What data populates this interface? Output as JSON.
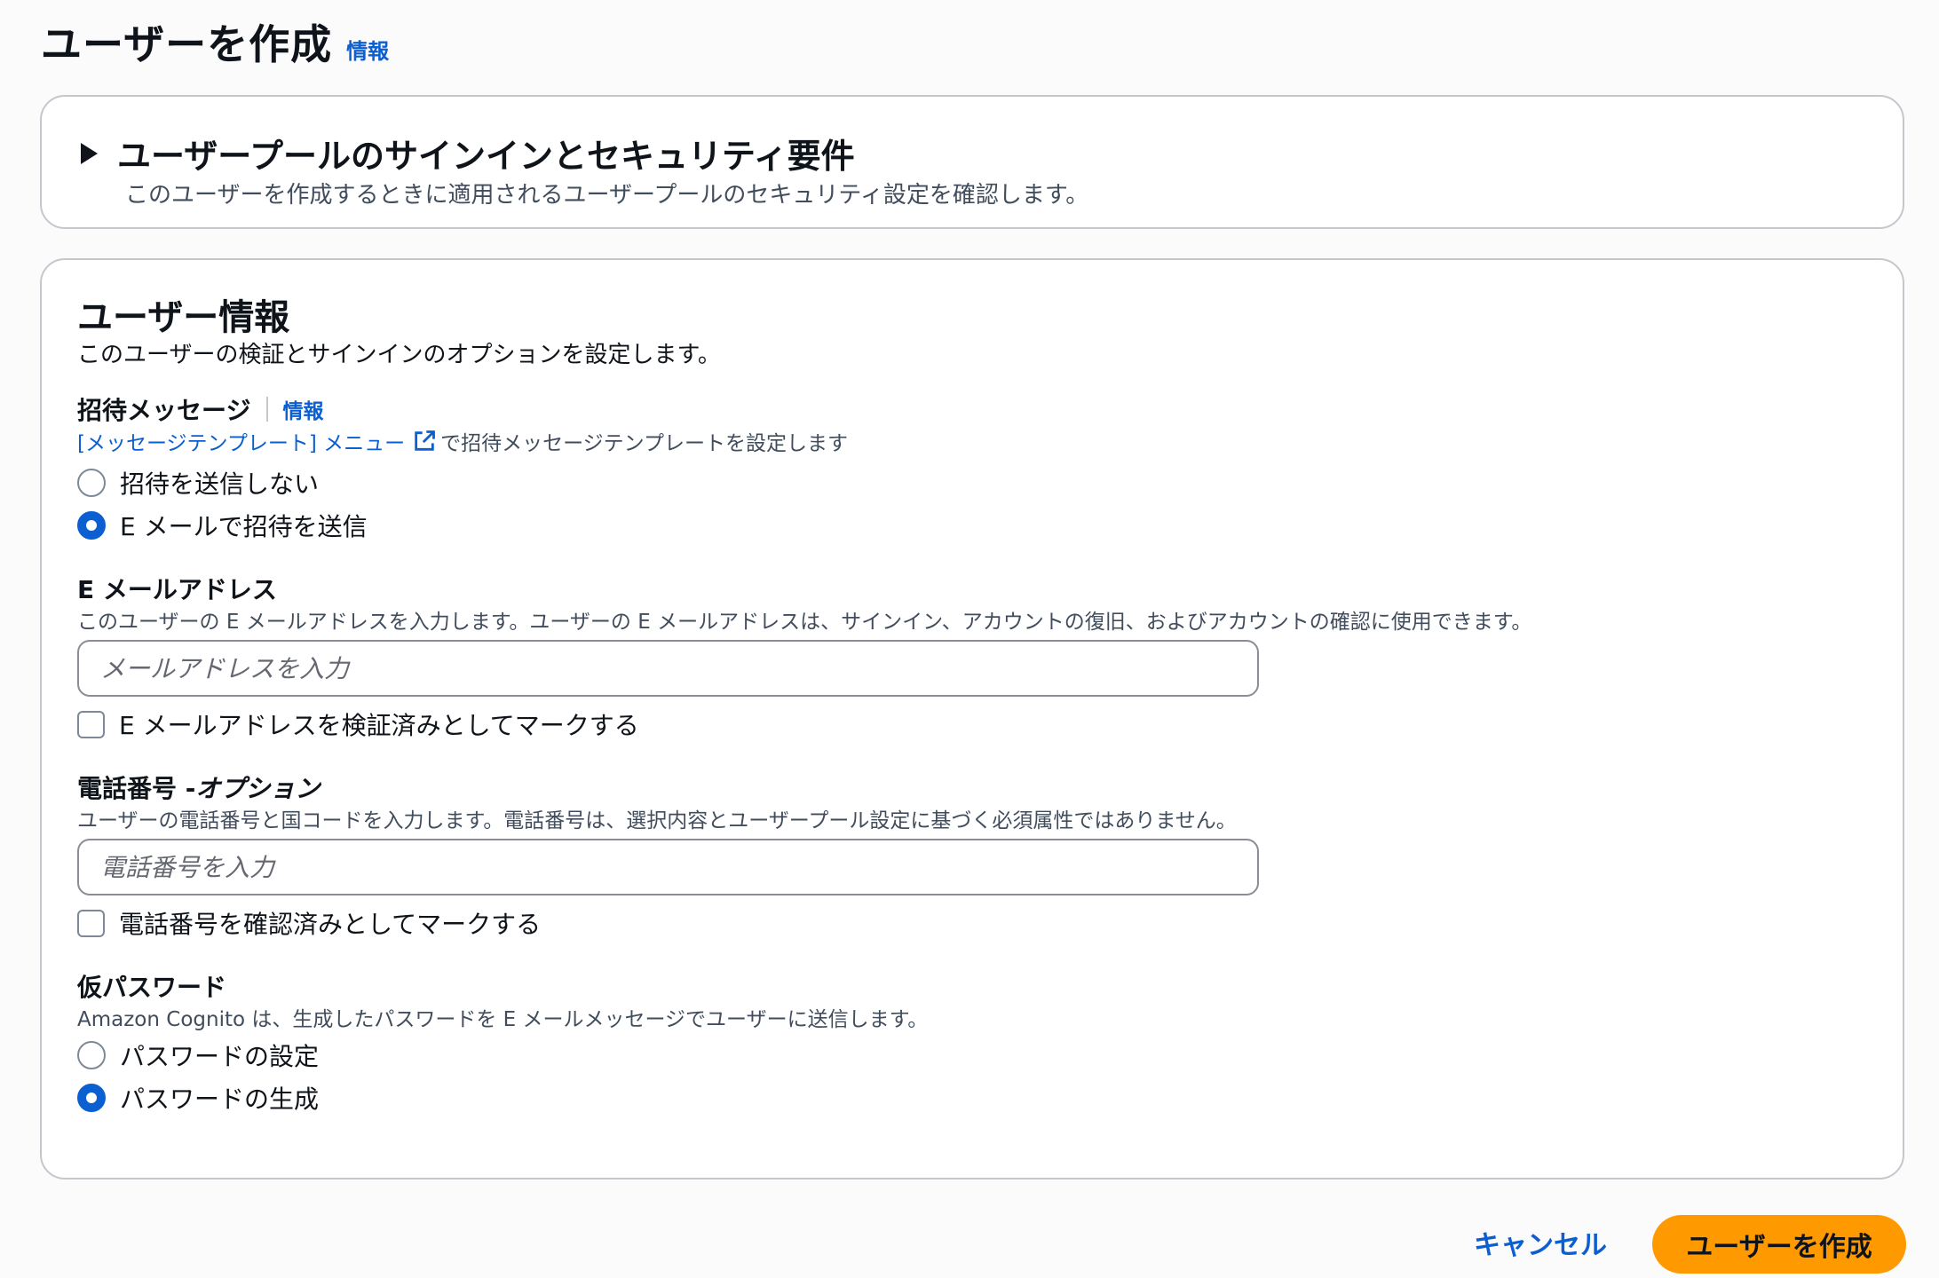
{
  "header": {
    "title": "ユーザーを作成",
    "info": "情報"
  },
  "security_panel": {
    "title": "ユーザープールのサインインとセキュリティ要件",
    "description": "このユーザーを作成するときに適用されるユーザープールのセキュリティ設定を確認します。",
    "expanded": false
  },
  "user_info": {
    "title": "ユーザー情報",
    "description": "このユーザーの検証とサインインのオプションを設定します。",
    "invitation": {
      "label": "招待メッセージ",
      "info": "情報",
      "template_link": "[メッセージテンプレート] メニュー",
      "template_suffix": "で招待メッセージテンプレートを設定します",
      "options": [
        {
          "label": "招待を送信しない",
          "selected": false
        },
        {
          "label": "E メールで招待を送信",
          "selected": true
        }
      ]
    },
    "email": {
      "label": "E メールアドレス",
      "description": "このユーザーの E メールアドレスを入力します。ユーザーの E メールアドレスは、サインイン、アカウントの復旧、およびアカウントの確認に使用できます。",
      "placeholder": "メールアドレスを入力",
      "value": "",
      "verify_checkbox": {
        "label": "E メールアドレスを検証済みとしてマークする",
        "checked": false
      }
    },
    "phone": {
      "label": "電話番号 - ",
      "label_optional": "オプション",
      "description": "ユーザーの電話番号と国コードを入力します。電話番号は、選択内容とユーザープール設定に基づく必須属性ではありません。",
      "placeholder": "電話番号を入力",
      "value": "",
      "verify_checkbox": {
        "label": "電話番号を確認済みとしてマークする",
        "checked": false
      }
    },
    "temp_password": {
      "label": "仮パスワード",
      "description": "Amazon Cognito は、生成したパスワードを E メールメッセージでユーザーに送信します。",
      "options": [
        {
          "label": "パスワードの設定",
          "selected": false
        },
        {
          "label": "パスワードの生成",
          "selected": true
        }
      ]
    }
  },
  "footer": {
    "cancel_label": "キャンセル",
    "create_label": "ユーザーを作成"
  },
  "colors": {
    "accent": "#0b5fd1",
    "primary_button": "#ff9900",
    "border": "#c6c6cd"
  },
  "icons": {
    "expand": "caret-right-icon",
    "external_link": "external-link-icon"
  }
}
